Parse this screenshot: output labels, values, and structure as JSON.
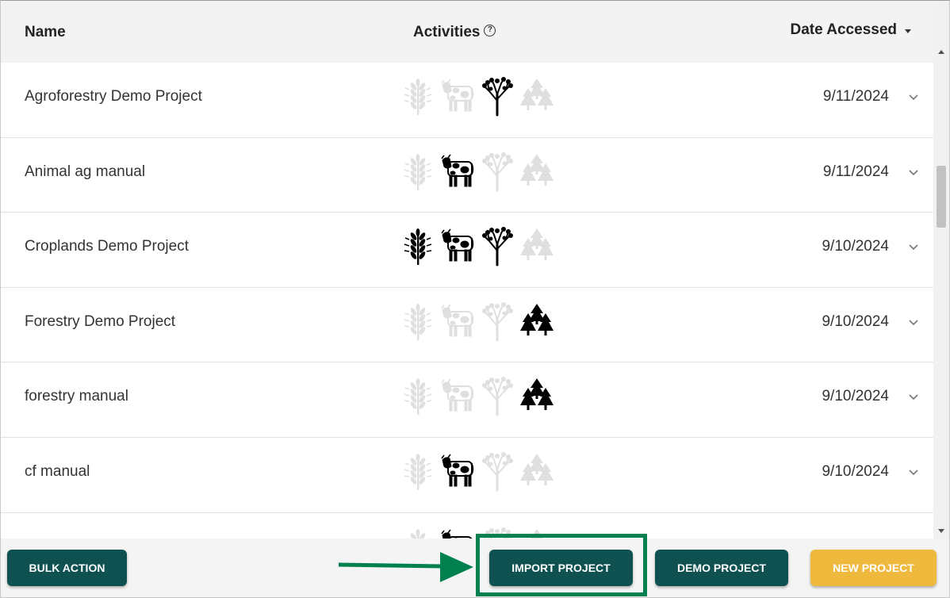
{
  "header": {
    "name_label": "Name",
    "activities_label": "Activities",
    "help_glyph": "?",
    "date_label": "Date Accessed"
  },
  "activity_icons": [
    "wheat-icon",
    "cow-icon",
    "tree-icon",
    "pine-trees-icon"
  ],
  "rows": [
    {
      "name": "Agroforestry Demo Project",
      "date": "9/11/2024",
      "active": [
        false,
        false,
        true,
        false
      ]
    },
    {
      "name": "Animal ag manual",
      "date": "9/11/2024",
      "active": [
        false,
        true,
        false,
        false
      ]
    },
    {
      "name": "Croplands Demo Project",
      "date": "9/10/2024",
      "active": [
        true,
        true,
        true,
        false
      ]
    },
    {
      "name": "Forestry Demo Project",
      "date": "9/10/2024",
      "active": [
        false,
        false,
        false,
        true
      ]
    },
    {
      "name": "forestry manual",
      "date": "9/10/2024",
      "active": [
        false,
        false,
        false,
        true
      ]
    },
    {
      "name": "cf manual",
      "date": "9/10/2024",
      "active": [
        false,
        true,
        false,
        false
      ]
    },
    {
      "name": "",
      "date": "",
      "active": [
        false,
        true,
        false,
        false
      ]
    }
  ],
  "footer": {
    "bulk_action": "BULK ACTION",
    "import_project": "IMPORT PROJECT",
    "demo_project": "DEMO PROJECT",
    "new_project": "NEW PROJECT"
  },
  "colors": {
    "primary_button": "#0f5151",
    "new_button": "#efb93e",
    "highlight_box": "#00804f",
    "arrow": "#00804f"
  }
}
